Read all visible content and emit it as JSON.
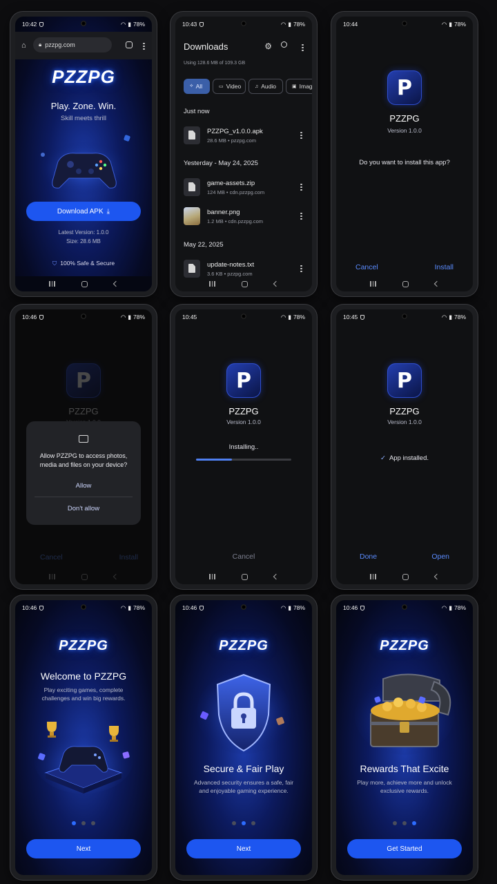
{
  "status_bar": {
    "screen1_time": "10:42",
    "screen2_time": "10:43",
    "screen3_time": "10:44",
    "screen4_time": "10:46",
    "screen5_time": "10:45",
    "screen6_time": "10:45",
    "screen7_time": "10:46",
    "screen8_time": "10:46",
    "screen9_time": "10:46",
    "battery": "78%"
  },
  "browser": {
    "url": "pzzpg.com",
    "brand": "PZZPG",
    "tagline": "Play. Zone. Win.",
    "subtagline": "Skill meets thrill",
    "download_button": "Download APK",
    "version_line": "Latest Version: 1.0.0",
    "size_line": "Size: 28.6 MB",
    "safe_badge": "100% Safe & Secure"
  },
  "downloads": {
    "title": "Downloads",
    "storage": "Using 128.6 MB of 109.3 GB",
    "chips": [
      "All",
      "Video",
      "Audio",
      "Imag"
    ],
    "sections": [
      {
        "header": "Just now",
        "items": [
          {
            "name": "PZZPG_v1.0.0.apk",
            "meta": "28.6 MB • pzzpg.com"
          }
        ]
      },
      {
        "header": "Yesterday - May 24, 2025",
        "items": [
          {
            "name": "game-assets.zip",
            "meta": "124 MB • cdn.pzzpg.com"
          },
          {
            "name": "banner.png",
            "meta": "1.2 MB • cdn.pzzpg.com"
          }
        ]
      },
      {
        "header": "May 22, 2025",
        "items": [
          {
            "name": "update-notes.txt",
            "meta": "3.6 KB • pzzpg.com"
          }
        ]
      }
    ]
  },
  "installer": {
    "app_name": "PZZPG",
    "version": "Version 1.0.0",
    "icon_letter": "P",
    "question": "Do you want to install this app?",
    "cancel": "Cancel",
    "install": "Install",
    "installing": "Installing..",
    "progress": 0.38,
    "installed": "App installed.",
    "done": "Done",
    "open": "Open"
  },
  "permission": {
    "message": "Allow PZZPG to access photos, media and files on your device?",
    "allow": "Allow",
    "deny": "Don't allow"
  },
  "onboarding": {
    "brand": "PZZPG",
    "slides": [
      {
        "title": "Welcome to PZZPG",
        "body": "Play exciting games, complete challenges and win big rewards.",
        "button": "Next",
        "active_dot": 0
      },
      {
        "title": "Secure & Fair Play",
        "body": "Advanced security ensures a safe, fair and enjoyable gaming experience.",
        "button": "Next",
        "active_dot": 1
      },
      {
        "title": "Rewards That Excite",
        "body": "Play more, achieve more and unlock exclusive rewards.",
        "button": "Get Started",
        "active_dot": 2
      }
    ]
  },
  "colors": {
    "accent": "#1d56f0",
    "link_blue": "#5b8cff",
    "background": "#0d0d0f"
  }
}
